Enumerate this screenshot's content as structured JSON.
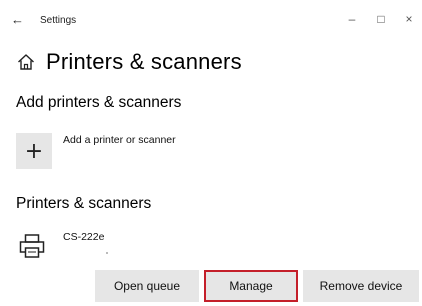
{
  "window": {
    "back_glyph": "←",
    "title": "Settings",
    "minimize_glyph": "–",
    "maximize_glyph": "□",
    "close_glyph": "×"
  },
  "page": {
    "title": "Printers & scanners",
    "icon": "home-icon"
  },
  "add_section": {
    "title": "Add printers & scanners",
    "add_button_glyph": "+",
    "add_label": "Add a printer or scanner"
  },
  "list_section": {
    "title": "Printers & scanners",
    "printers": [
      {
        "name": "CS-222e",
        "icon": "printer-icon"
      }
    ]
  },
  "actions": {
    "open_queue": "Open queue",
    "manage": "Manage",
    "remove_device": "Remove device"
  },
  "colors": {
    "highlight_border": "#c41f2a",
    "button_bg": "#e6e6e6"
  }
}
